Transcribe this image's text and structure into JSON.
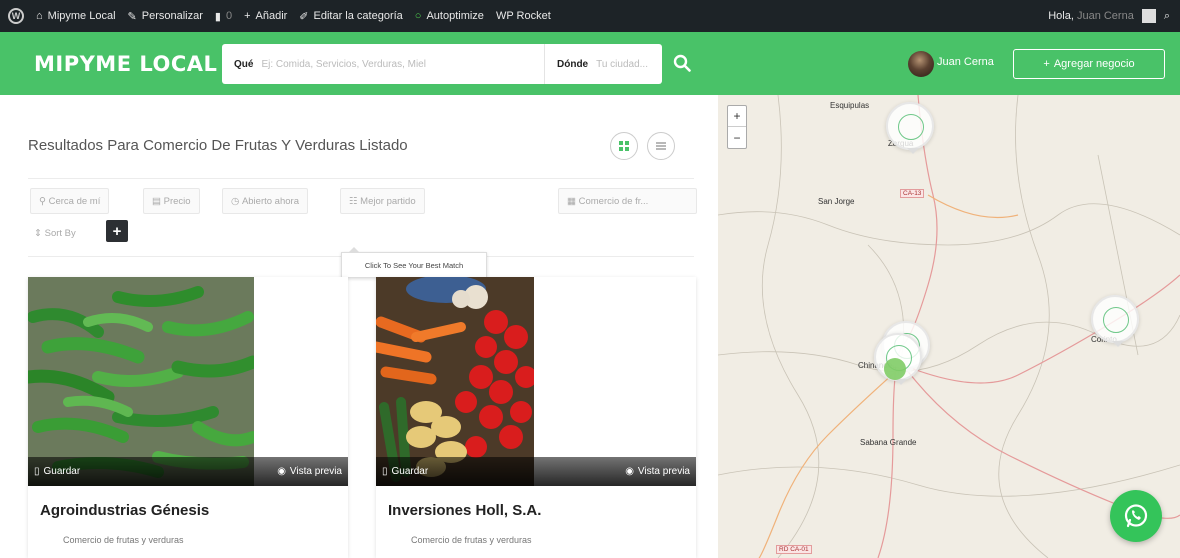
{
  "adminbar": {
    "site": "Mipyme Local",
    "customize": "Personalizar",
    "comments": "0",
    "add": "Añadir",
    "edit_category": "Editar la categoría",
    "autoptimize": "Autoptimize",
    "wp_rocket": "WP Rocket",
    "greeting": "Hola,",
    "greeting_name": "Juan Cerna"
  },
  "header": {
    "logo": "MIPYME LOCAL",
    "what_label": "Qué",
    "what_placeholder": "Ej: Comida, Servicios, Verduras, Miel",
    "where_label": "Dónde",
    "where_placeholder": "Tu ciudad...",
    "user_name": "Juan Cerna",
    "add_business": "Agregar negocio"
  },
  "results": {
    "title": "Resultados Para Comercio De Frutas Y Verduras Listado",
    "filters": {
      "near_me": "Cerca de mí",
      "price": "Precio",
      "open_now": "Abierto ahora",
      "best_match": "Mejor partido",
      "category": "Comercio de fr...",
      "sort_by": "Sort By"
    },
    "tooltip": "Click To See Your Best Match",
    "cards": [
      {
        "name": "Agroindustrias Génesis",
        "category": "Comercio de frutas y verduras",
        "save": "Guardar",
        "preview": "Vista previa"
      },
      {
        "name": "Inversiones Holl, S.A.",
        "category": "Comercio de frutas y verduras",
        "save": "Guardar",
        "preview": "Vista previa"
      }
    ]
  },
  "map": {
    "zoom_in": "+",
    "zoom_out": "−",
    "labels": {
      "esquipulas": "Esquipulas",
      "zargua": "Zargua",
      "san_jorge": "San Jorge",
      "chinandega": "Chinandega",
      "corinto": "Corinto",
      "sabana_grande": "Sabana Grande",
      "road1": "CA-13",
      "road2": "RD CA-01"
    }
  },
  "colors": {
    "brand_green": "#49c268",
    "adminbar_bg": "#1d2327",
    "whatsapp_green": "#34c45a"
  }
}
